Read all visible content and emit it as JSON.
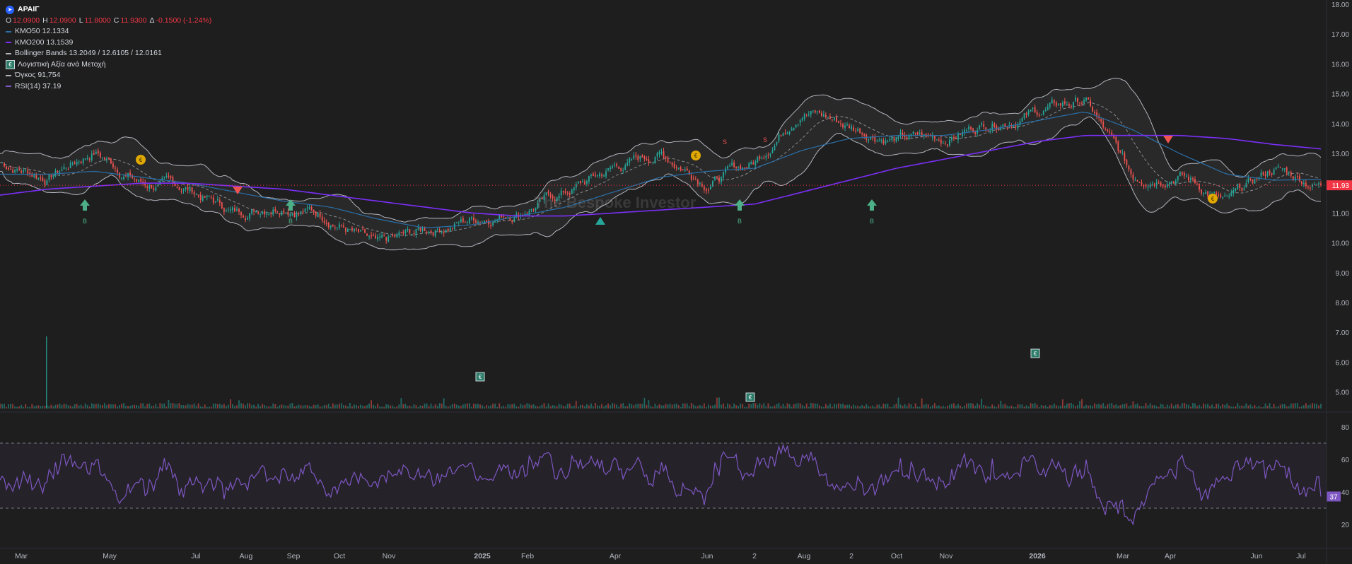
{
  "legend": {
    "ticker": "ΑΡΑΙΓ",
    "ohlc": {
      "o_label": "O",
      "o": "12.0900",
      "h_label": "H",
      "h": "12.0900",
      "l_label": "L",
      "l": "11.8000",
      "c_label": "C",
      "c": "11.9300",
      "d_label": "Δ",
      "d": "-0.1500 (-1.24%)"
    },
    "ma50": "ΚΜΟ50 12.1334",
    "ma200": "ΚΜΟ200 13.1539",
    "bb": "Bollinger Bands 13.2049 / 12.6105 / 12.0161",
    "bvps": "Λογιστική Αξία ανά Μετοχή",
    "volume": "Όγκος 91,754",
    "rsi": "RSI(14) 37.19"
  },
  "watermark": "The Bespoke Investor",
  "colors": {
    "background": "#1e1e1e",
    "up": "#26a69a",
    "down": "#ef5350",
    "ma50": "#2a6fa8",
    "ma200": "#7b2ff7",
    "bb": "#b2b5be",
    "rsi": "#7e57c2",
    "last_price": "#f23645"
  },
  "price_axis": {
    "ticks": [
      "18.00",
      "17.00",
      "16.00",
      "15.00",
      "14.00",
      "13.00",
      "12.00",
      "11.00",
      "10.00",
      "9.00",
      "8.00",
      "7.00",
      "6.00",
      "5.00"
    ],
    "last_price_label": "11.93"
  },
  "rsi_axis": {
    "ticks": [
      "80",
      "60",
      "40",
      "20"
    ],
    "last_label": "37"
  },
  "time_axis": {
    "labels": [
      "Mar",
      "May",
      "Jul",
      "Aug",
      "Sep",
      "Oct",
      "Nov",
      "2025",
      "Feb",
      "Apr",
      "Jun",
      "2",
      "Aug",
      "2",
      "Oct",
      "Nov",
      "2026",
      "Mar",
      "Apr",
      "Jun",
      "Jul"
    ]
  },
  "events": {
    "buy_label": "B",
    "sell_label": "S",
    "dividend_label": "€",
    "bvps_label": "€"
  },
  "chart_data": {
    "type": "line",
    "title": "ΑΡΑΙΓ",
    "x": [
      "2024-03",
      "2024-04",
      "2024-05",
      "2024-06",
      "2024-07",
      "2024-08",
      "2024-09",
      "2024-10",
      "2024-11",
      "2024-12",
      "2025-01",
      "2025-02",
      "2025-03",
      "2025-04",
      "2025-05",
      "2025-06",
      "2025-07",
      "2025-08",
      "2025-09",
      "2025-10",
      "2025-11",
      "2025-12",
      "2026-01",
      "2026-02",
      "2026-03",
      "2026-04",
      "2026-05",
      "2026-06",
      "2026-07"
    ],
    "series": [
      {
        "name": "ΑΡΑΙΓ",
        "values": [
          12.7,
          12.2,
          13.1,
          12.0,
          11.8,
          11.0,
          11.4,
          10.9,
          9.8,
          10.4,
          10.8,
          11.1,
          11.7,
          12.5,
          13.0,
          12.1,
          12.7,
          14.6,
          13.9,
          13.5,
          13.5,
          14.1,
          14.4,
          14.8,
          12.2,
          12.4,
          11.3,
          12.5,
          11.93
        ]
      },
      {
        "name": "ΚΜΟ50",
        "values": [
          12.3,
          12.3,
          12.4,
          12.2,
          12.0,
          11.7,
          11.4,
          11.2,
          10.8,
          10.5,
          10.6,
          10.9,
          11.2,
          11.7,
          12.2,
          12.4,
          12.5,
          13.1,
          13.5,
          13.6,
          13.6,
          13.8,
          14.1,
          14.4,
          13.8,
          13.0,
          12.3,
          12.1,
          12.13
        ]
      },
      {
        "name": "ΚΜΟ200",
        "values": [
          11.6,
          11.8,
          11.9,
          12.0,
          12.0,
          11.9,
          11.8,
          11.6,
          11.4,
          11.2,
          11.0,
          10.9,
          10.9,
          11.0,
          11.1,
          11.2,
          11.3,
          11.7,
          12.1,
          12.5,
          12.8,
          13.1,
          13.4,
          13.6,
          13.6,
          13.6,
          13.5,
          13.3,
          13.15
        ]
      }
    ],
    "ylim": [
      5,
      18
    ],
    "last_price": 11.93,
    "rsi_last": 37.19,
    "rsi_levels": [
      70,
      30
    ],
    "volume_last": 91754,
    "grid": false,
    "legend_position": "top-left"
  }
}
